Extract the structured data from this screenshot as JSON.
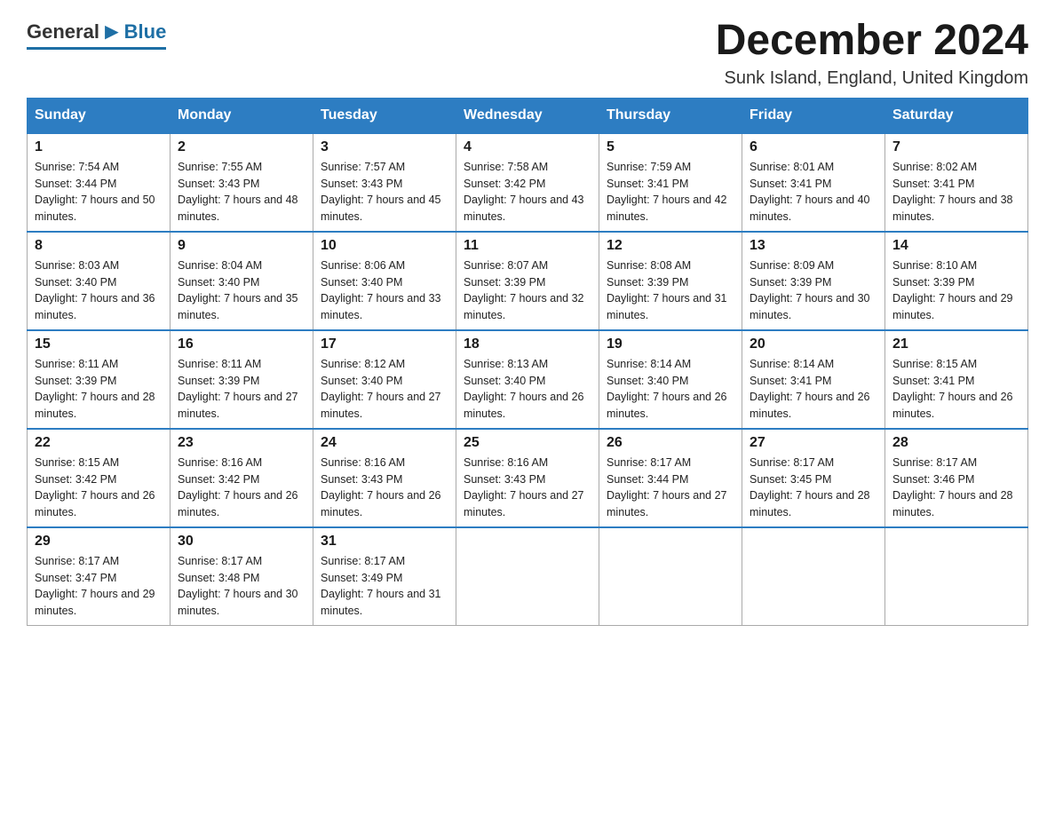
{
  "logo": {
    "general": "General",
    "blue": "Blue"
  },
  "title": "December 2024",
  "location": "Sunk Island, England, United Kingdom",
  "days_of_week": [
    "Sunday",
    "Monday",
    "Tuesday",
    "Wednesday",
    "Thursday",
    "Friday",
    "Saturday"
  ],
  "weeks": [
    [
      {
        "day": "1",
        "sunrise": "7:54 AM",
        "sunset": "3:44 PM",
        "daylight": "7 hours and 50 minutes."
      },
      {
        "day": "2",
        "sunrise": "7:55 AM",
        "sunset": "3:43 PM",
        "daylight": "7 hours and 48 minutes."
      },
      {
        "day": "3",
        "sunrise": "7:57 AM",
        "sunset": "3:43 PM",
        "daylight": "7 hours and 45 minutes."
      },
      {
        "day": "4",
        "sunrise": "7:58 AM",
        "sunset": "3:42 PM",
        "daylight": "7 hours and 43 minutes."
      },
      {
        "day": "5",
        "sunrise": "7:59 AM",
        "sunset": "3:41 PM",
        "daylight": "7 hours and 42 minutes."
      },
      {
        "day": "6",
        "sunrise": "8:01 AM",
        "sunset": "3:41 PM",
        "daylight": "7 hours and 40 minutes."
      },
      {
        "day": "7",
        "sunrise": "8:02 AM",
        "sunset": "3:41 PM",
        "daylight": "7 hours and 38 minutes."
      }
    ],
    [
      {
        "day": "8",
        "sunrise": "8:03 AM",
        "sunset": "3:40 PM",
        "daylight": "7 hours and 36 minutes."
      },
      {
        "day": "9",
        "sunrise": "8:04 AM",
        "sunset": "3:40 PM",
        "daylight": "7 hours and 35 minutes."
      },
      {
        "day": "10",
        "sunrise": "8:06 AM",
        "sunset": "3:40 PM",
        "daylight": "7 hours and 33 minutes."
      },
      {
        "day": "11",
        "sunrise": "8:07 AM",
        "sunset": "3:39 PM",
        "daylight": "7 hours and 32 minutes."
      },
      {
        "day": "12",
        "sunrise": "8:08 AM",
        "sunset": "3:39 PM",
        "daylight": "7 hours and 31 minutes."
      },
      {
        "day": "13",
        "sunrise": "8:09 AM",
        "sunset": "3:39 PM",
        "daylight": "7 hours and 30 minutes."
      },
      {
        "day": "14",
        "sunrise": "8:10 AM",
        "sunset": "3:39 PM",
        "daylight": "7 hours and 29 minutes."
      }
    ],
    [
      {
        "day": "15",
        "sunrise": "8:11 AM",
        "sunset": "3:39 PM",
        "daylight": "7 hours and 28 minutes."
      },
      {
        "day": "16",
        "sunrise": "8:11 AM",
        "sunset": "3:39 PM",
        "daylight": "7 hours and 27 minutes."
      },
      {
        "day": "17",
        "sunrise": "8:12 AM",
        "sunset": "3:40 PM",
        "daylight": "7 hours and 27 minutes."
      },
      {
        "day": "18",
        "sunrise": "8:13 AM",
        "sunset": "3:40 PM",
        "daylight": "7 hours and 26 minutes."
      },
      {
        "day": "19",
        "sunrise": "8:14 AM",
        "sunset": "3:40 PM",
        "daylight": "7 hours and 26 minutes."
      },
      {
        "day": "20",
        "sunrise": "8:14 AM",
        "sunset": "3:41 PM",
        "daylight": "7 hours and 26 minutes."
      },
      {
        "day": "21",
        "sunrise": "8:15 AM",
        "sunset": "3:41 PM",
        "daylight": "7 hours and 26 minutes."
      }
    ],
    [
      {
        "day": "22",
        "sunrise": "8:15 AM",
        "sunset": "3:42 PM",
        "daylight": "7 hours and 26 minutes."
      },
      {
        "day": "23",
        "sunrise": "8:16 AM",
        "sunset": "3:42 PM",
        "daylight": "7 hours and 26 minutes."
      },
      {
        "day": "24",
        "sunrise": "8:16 AM",
        "sunset": "3:43 PM",
        "daylight": "7 hours and 26 minutes."
      },
      {
        "day": "25",
        "sunrise": "8:16 AM",
        "sunset": "3:43 PM",
        "daylight": "7 hours and 27 minutes."
      },
      {
        "day": "26",
        "sunrise": "8:17 AM",
        "sunset": "3:44 PM",
        "daylight": "7 hours and 27 minutes."
      },
      {
        "day": "27",
        "sunrise": "8:17 AM",
        "sunset": "3:45 PM",
        "daylight": "7 hours and 28 minutes."
      },
      {
        "day": "28",
        "sunrise": "8:17 AM",
        "sunset": "3:46 PM",
        "daylight": "7 hours and 28 minutes."
      }
    ],
    [
      {
        "day": "29",
        "sunrise": "8:17 AM",
        "sunset": "3:47 PM",
        "daylight": "7 hours and 29 minutes."
      },
      {
        "day": "30",
        "sunrise": "8:17 AM",
        "sunset": "3:48 PM",
        "daylight": "7 hours and 30 minutes."
      },
      {
        "day": "31",
        "sunrise": "8:17 AM",
        "sunset": "3:49 PM",
        "daylight": "7 hours and 31 minutes."
      },
      null,
      null,
      null,
      null
    ]
  ]
}
